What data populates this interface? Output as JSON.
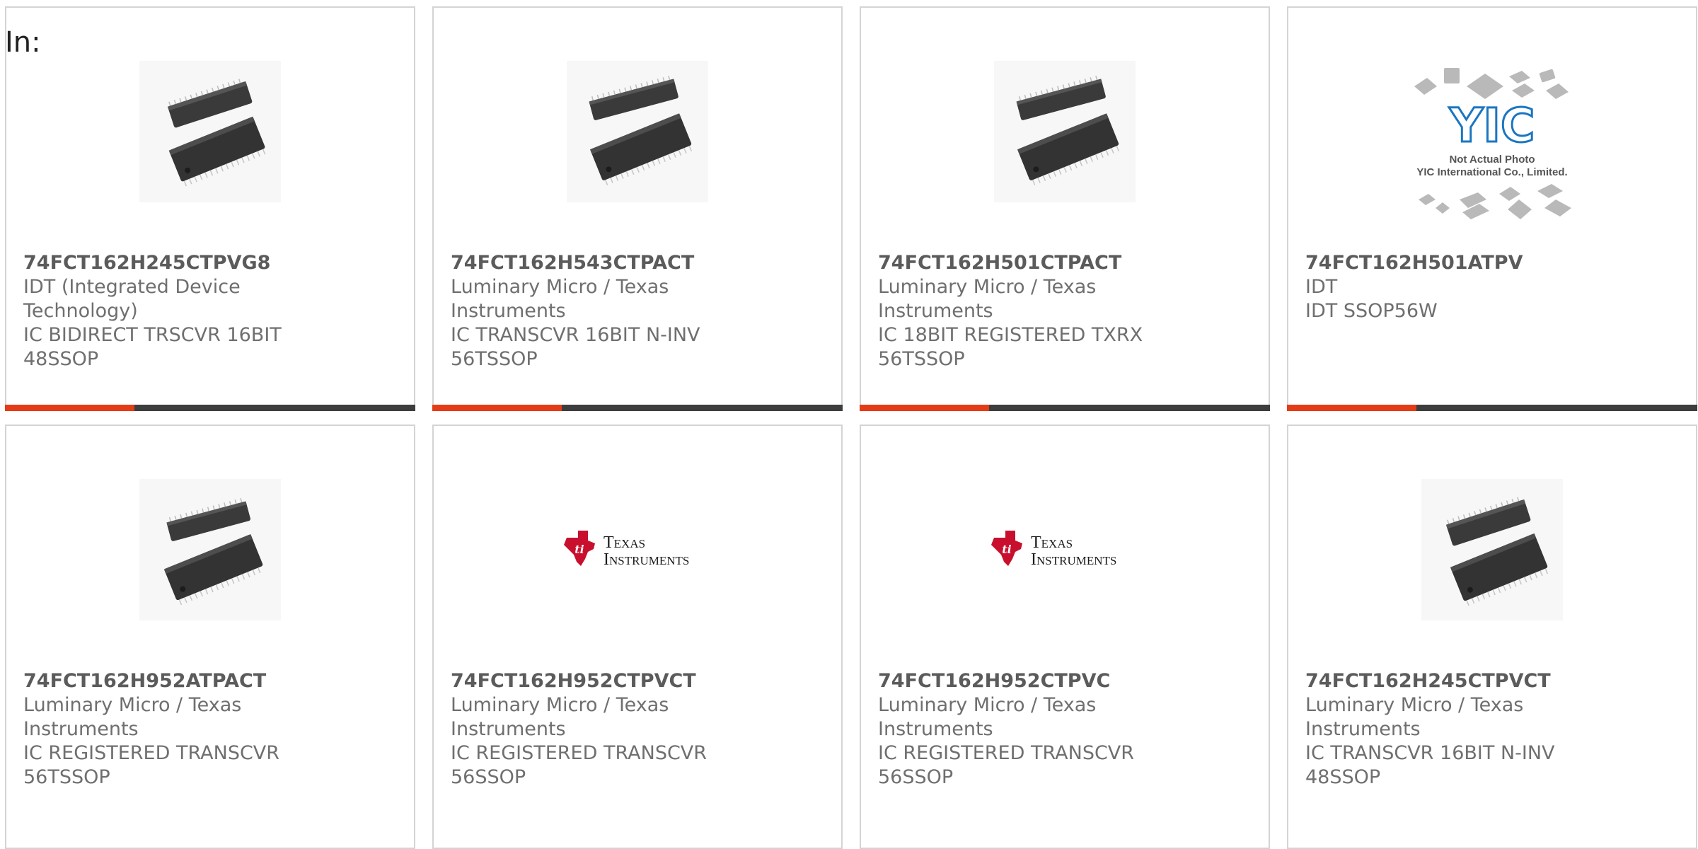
{
  "page": {
    "label": "In:"
  },
  "products": [
    {
      "part_number": "74FCT162H245CTPVG8",
      "manufacturer": "IDT (Integrated Device Technology)",
      "description": "IC BIDIRECT TRSCVR 16BIT 48SSOP",
      "image": "ic-chip-photo"
    },
    {
      "part_number": "74FCT162H543CTPACT",
      "manufacturer": "Luminary Micro / Texas Instruments",
      "description": "IC TRANSCVR 16BIT N-INV 56TSSOP",
      "image": "ic-chip-photo"
    },
    {
      "part_number": "74FCT162H501CTPACT",
      "manufacturer": "Luminary Micro / Texas Instruments",
      "description": "IC 18BIT REGISTERED TXRX 56TSSOP",
      "image": "ic-chip-photo"
    },
    {
      "part_number": "74FCT162H501ATPV",
      "manufacturer": "IDT",
      "description": "IDT SSOP56W",
      "image": "placeholder-logo",
      "placeholder_logo_text": "YIC",
      "placeholder_caption_line1": "Not Actual Photo",
      "placeholder_caption_line2": "YIC International Co., Limited."
    },
    {
      "part_number": "74FCT162H952ATPACT",
      "manufacturer": "Luminary Micro / Texas Instruments",
      "description": "IC REGISTERED TRANSCVR 56TSSOP",
      "image": "ic-chip-photo"
    },
    {
      "part_number": "74FCT162H952CTPVCT",
      "manufacturer": "Luminary Micro / Texas Instruments",
      "description": "IC REGISTERED TRANSCVR 56SSOP",
      "image": "texas-instruments-logo",
      "logo_line1": "Texas",
      "logo_line2": "Instruments"
    },
    {
      "part_number": "74FCT162H952CTPVC",
      "manufacturer": "Luminary Micro / Texas Instruments",
      "description": "IC REGISTERED TRANSCVR 56SSOP",
      "image": "texas-instruments-logo",
      "logo_line1": "Texas",
      "logo_line2": "Instruments"
    },
    {
      "part_number": "74FCT162H245CTPVCT",
      "manufacturer": "Luminary Micro / Texas Instruments",
      "description": "IC TRANSCVR 16BIT N-INV 48SSOP",
      "image": "ic-chip-photo"
    }
  ],
  "colors": {
    "accent_red": "#e43c16",
    "accent_dark": "#3d3d3d",
    "ti_red": "#c8102e",
    "yic_blue": "#1a76c2"
  }
}
